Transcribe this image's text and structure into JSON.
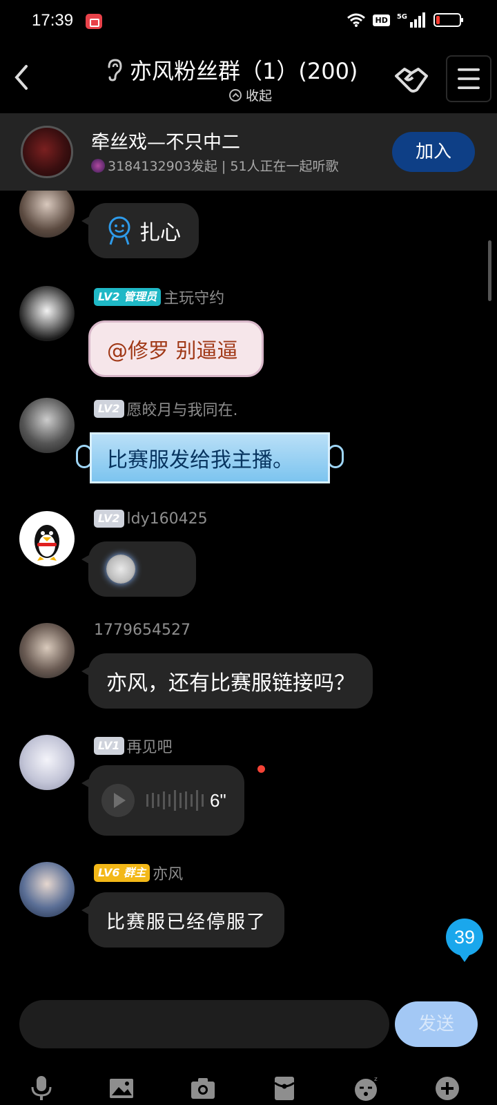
{
  "status_bar": {
    "time": "17:39",
    "hd": "HD",
    "network": "5G"
  },
  "header": {
    "title": "亦风粉丝群（1）(200)",
    "collapse_label": "收起"
  },
  "listen": {
    "title": "牵丝戏—不只中二",
    "subtitle": "3184132903发起 | 51人正在一起听歌",
    "join_label": "加入"
  },
  "messages": [
    {
      "text": "扎心"
    },
    {
      "level": "LV2",
      "role": "管理员",
      "name": "主玩守约",
      "text": "@修罗 别逼逼"
    },
    {
      "level": "LV2",
      "name": "愿皎月与我同在.",
      "text": "比赛服发给我主播。"
    },
    {
      "level": "LV2",
      "name": "ldy160425"
    },
    {
      "name": "1779654527",
      "text": "亦风，还有比赛服链接吗？"
    },
    {
      "level": "LV1",
      "name": "再见吧",
      "voice_duration": "6\""
    },
    {
      "level": "LV6",
      "role": "群主",
      "name": "亦风",
      "text": "比赛服已经停服了"
    }
  ],
  "unread_count": "39",
  "input": {
    "placeholder": "",
    "send_label": "发送"
  },
  "icons": {
    "header": [
      "back-icon",
      "listen-ear-icon",
      "handshake-icon",
      "menu-icon"
    ],
    "tools": [
      "mic-icon",
      "image-icon",
      "camera-icon",
      "red-packet-icon",
      "emoji-icon",
      "plus-icon"
    ]
  },
  "colors": {
    "background": "#000000",
    "bubble": "#262626",
    "join": "#0e3f86",
    "send": "#a3c8f5",
    "badge": "#1aa7ec"
  }
}
